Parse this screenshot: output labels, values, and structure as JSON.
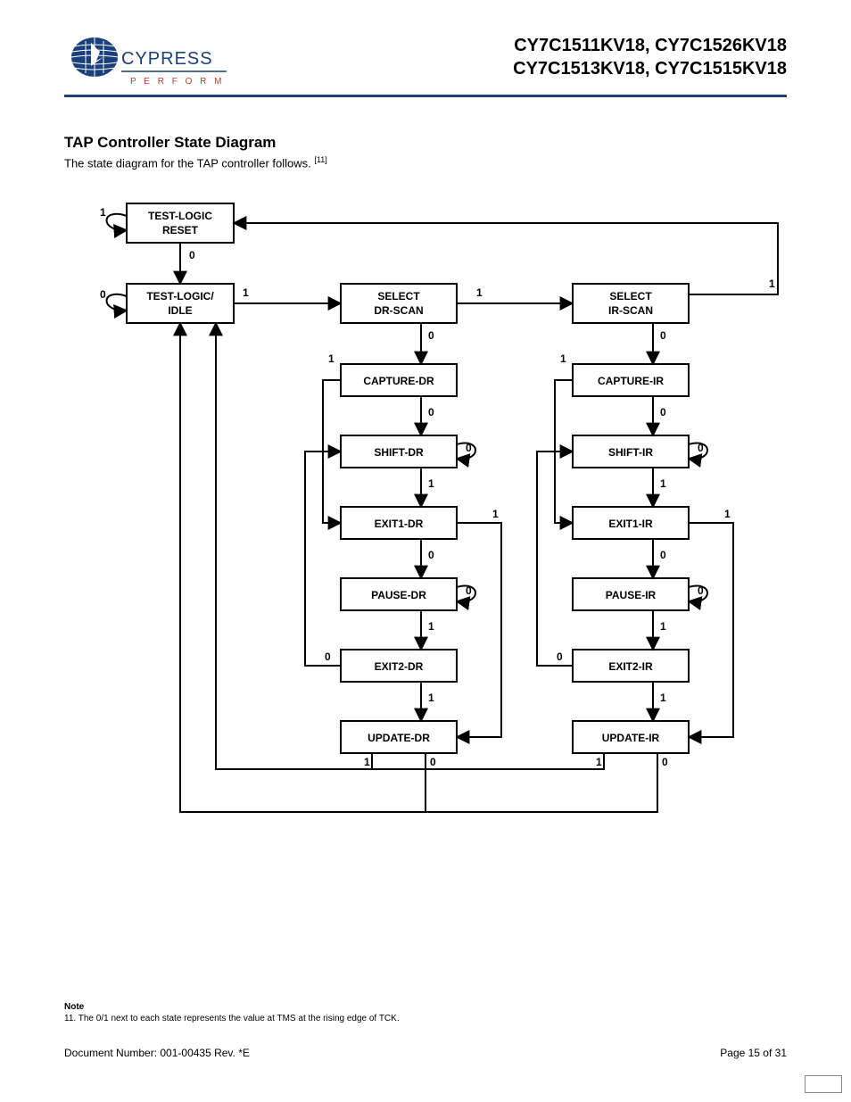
{
  "header": {
    "logo_text_top": "CYPRESS",
    "logo_text_bottom": "P E R F O R M",
    "parts_line1": "CY7C1511KV18, CY7C1526KV18",
    "parts_line2": "CY7C1513KV18, CY7C1515KV18"
  },
  "section": {
    "title": "TAP Controller State Diagram",
    "caption": "The state diagram for the TAP controller follows. ",
    "caption_ref": "[11]"
  },
  "diagram": {
    "states": {
      "tlr": "TEST-LOGIC RESET",
      "rti": "TEST-LOGIC/ IDLE",
      "sdr": "SELECT DR-SCAN",
      "sir": "SELECT IR-SCAN",
      "cdr": "CAPTURE-DR",
      "cir": "CAPTURE-IR",
      "shdr": "SHIFT-DR",
      "shir": "SHIFT-IR",
      "e1dr": "EXIT1-DR",
      "e1ir": "EXIT1-IR",
      "pdr": "PAUSE-DR",
      "pir": "PAUSE-IR",
      "e2dr": "EXIT2-DR",
      "e2ir": "EXIT2-IR",
      "udr": "UPDATE-DR",
      "uir": "UPDATE-IR"
    },
    "edges": [
      {
        "from": "tlr",
        "to": "tlr",
        "label": "1"
      },
      {
        "from": "tlr",
        "to": "rti",
        "label": "0"
      },
      {
        "from": "rti",
        "to": "rti",
        "label": "0"
      },
      {
        "from": "rti",
        "to": "sdr",
        "label": "1"
      },
      {
        "from": "sdr",
        "to": "sir",
        "label": "1"
      },
      {
        "from": "sdr",
        "to": "cdr",
        "label": "0"
      },
      {
        "from": "sir",
        "to": "tlr",
        "label": "1"
      },
      {
        "from": "sir",
        "to": "cir",
        "label": "0"
      },
      {
        "from": "cdr",
        "to": "shdr",
        "label": "0"
      },
      {
        "from": "cdr",
        "to": "e1dr",
        "label": "1"
      },
      {
        "from": "shdr",
        "to": "shdr",
        "label": "0"
      },
      {
        "from": "shdr",
        "to": "e1dr",
        "label": "1"
      },
      {
        "from": "e1dr",
        "to": "pdr",
        "label": "0"
      },
      {
        "from": "e1dr",
        "to": "udr",
        "label": "1"
      },
      {
        "from": "pdr",
        "to": "pdr",
        "label": "0"
      },
      {
        "from": "pdr",
        "to": "e2dr",
        "label": "1"
      },
      {
        "from": "e2dr",
        "to": "shdr",
        "label": "0"
      },
      {
        "from": "e2dr",
        "to": "udr",
        "label": "1"
      },
      {
        "from": "udr",
        "to": "sdr",
        "label": "1"
      },
      {
        "from": "udr",
        "to": "rti",
        "label": "0"
      },
      {
        "from": "cir",
        "to": "shir",
        "label": "0"
      },
      {
        "from": "cir",
        "to": "e1ir",
        "label": "1"
      },
      {
        "from": "shir",
        "to": "shir",
        "label": "0"
      },
      {
        "from": "shir",
        "to": "e1ir",
        "label": "1"
      },
      {
        "from": "e1ir",
        "to": "pir",
        "label": "0"
      },
      {
        "from": "e1ir",
        "to": "uir",
        "label": "1"
      },
      {
        "from": "pir",
        "to": "pir",
        "label": "0"
      },
      {
        "from": "pir",
        "to": "e2ir",
        "label": "1"
      },
      {
        "from": "e2ir",
        "to": "shir",
        "label": "0"
      },
      {
        "from": "e2ir",
        "to": "uir",
        "label": "1"
      },
      {
        "from": "uir",
        "to": "sdr",
        "label": "1"
      },
      {
        "from": "uir",
        "to": "rti",
        "label": "0"
      }
    ]
  },
  "note": {
    "heading": "Note",
    "text": "11. The 0/1 next to each state represents the value at TMS at the rising edge of TCK."
  },
  "footer": {
    "doc": "Document Number: 001-00435 Rev. *E",
    "page": "Page 15 of 31"
  }
}
